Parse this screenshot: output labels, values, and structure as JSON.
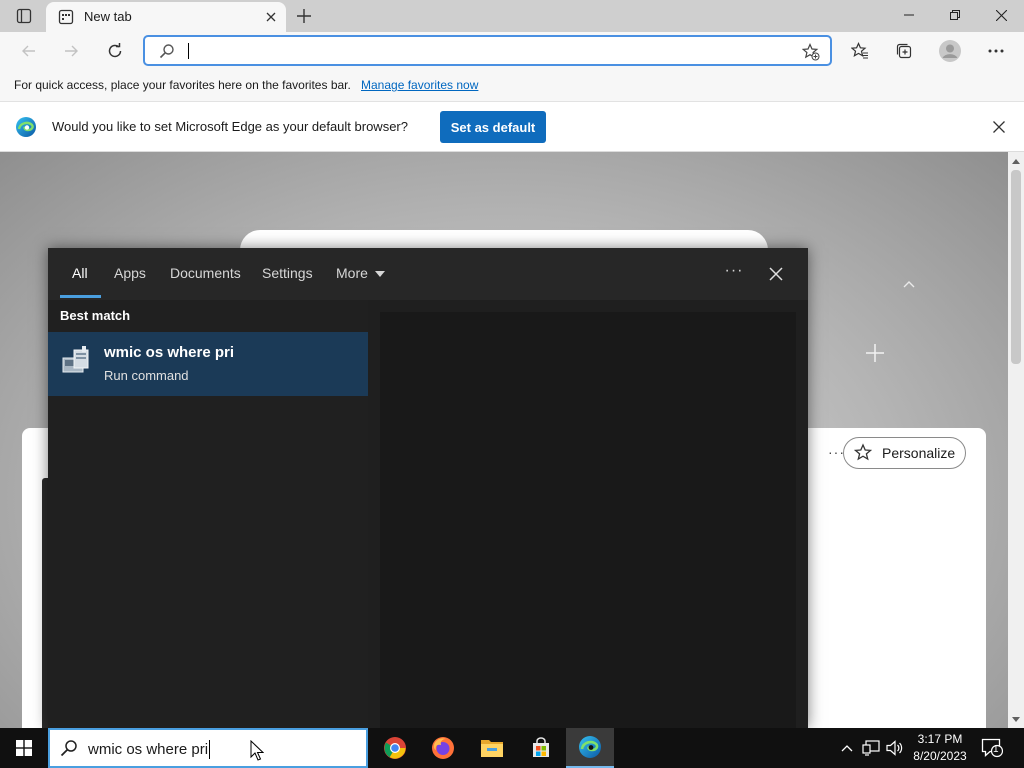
{
  "browser": {
    "tab": {
      "title": "New tab"
    },
    "favorites_bar": {
      "text": "For quick access, place your favorites here on the favorites bar.",
      "link": "Manage favorites now"
    },
    "infobar": {
      "message": "Would you like to set Microsoft Edge as your default browser?",
      "button": "Set as default"
    },
    "page": {
      "personalize_label": "Personalize",
      "more_label": "···"
    }
  },
  "search_panel": {
    "tabs": [
      {
        "label": "All",
        "active": true
      },
      {
        "label": "Apps"
      },
      {
        "label": "Documents"
      },
      {
        "label": "Settings"
      },
      {
        "label": "More"
      }
    ],
    "ellipsis": "···",
    "best_match_label": "Best match",
    "result": {
      "title": "wmic os where pri",
      "subtitle": "Run command"
    }
  },
  "taskbar": {
    "search_text": "wmic os where pri",
    "apps": [
      "chrome-icon",
      "firefox-icon",
      "file-explorer-icon",
      "store-icon",
      "edge-icon"
    ],
    "clock": {
      "time": "3:17 PM",
      "date": "8/20/2023"
    },
    "notification_count": "1"
  },
  "colors": {
    "accent": "#0f6cbd",
    "panel_bg": "#1f1f1f",
    "result_highlight": "#1b3a57",
    "taskbar_bg": "#101010"
  }
}
